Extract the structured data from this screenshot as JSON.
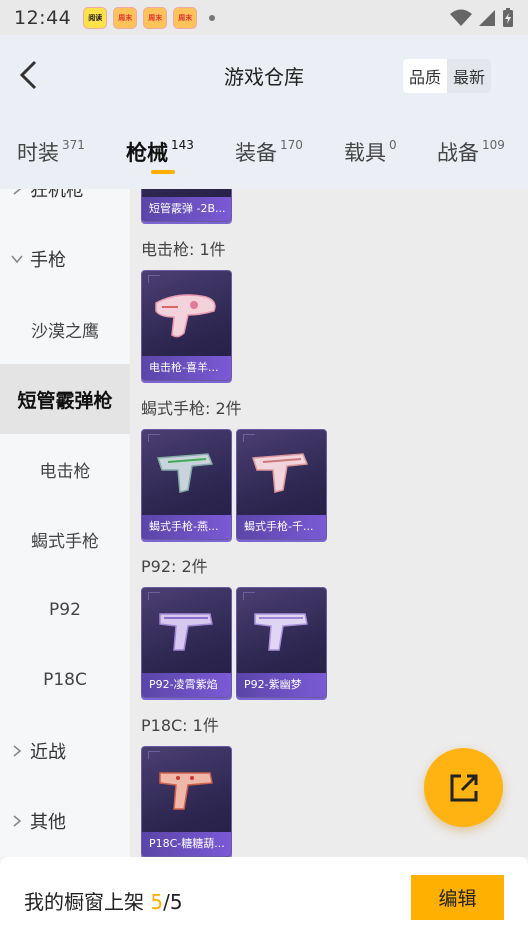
{
  "status_bar": {
    "time": "12:44",
    "apps": [
      "阅读",
      "周末",
      "周末",
      "周末"
    ]
  },
  "header": {
    "title": "游戏仓库",
    "sort_quality": "品质",
    "sort_newest": "最新",
    "back_icon": "chevron-left-icon"
  },
  "tabs": [
    {
      "label": "时装",
      "count": "371"
    },
    {
      "label": "枪械",
      "count": "143"
    },
    {
      "label": "装备",
      "count": "170"
    },
    {
      "label": "载具",
      "count": "0"
    },
    {
      "label": "战备",
      "count": "109"
    }
  ],
  "active_tab_index": 1,
  "accent_color": "#ffb000",
  "sidebar": {
    "items": [
      {
        "label": "狂机枪",
        "type": "group"
      },
      {
        "label": "手枪",
        "type": "group"
      },
      {
        "label": "沙漠之鹰",
        "type": "sub"
      },
      {
        "label": "短管霰弹枪",
        "type": "sub",
        "active": true
      },
      {
        "label": "电击枪",
        "type": "sub"
      },
      {
        "label": "蝎式手枪",
        "type": "sub"
      },
      {
        "label": "P92",
        "type": "sub"
      },
      {
        "label": "P18C",
        "type": "sub"
      },
      {
        "label": "近战",
        "type": "group"
      },
      {
        "label": "其他",
        "type": "group"
      }
    ]
  },
  "content": {
    "partial_card_label": "短管霰弹 -2B...",
    "sections": [
      {
        "title": "电击枪: 1件",
        "items": [
          {
            "label": "电击枪-喜羊..."
          }
        ]
      },
      {
        "title": "蝎式手枪: 2件",
        "items": [
          {
            "label": "蝎式手枪-燕..."
          },
          {
            "label": "蝎式手枪-千..."
          }
        ]
      },
      {
        "title": "P92: 2件",
        "items": [
          {
            "label": "P92-凌霄紫焰"
          },
          {
            "label": "P92-紫幽梦"
          }
        ]
      },
      {
        "title": "P18C: 1件",
        "items": [
          {
            "label": "P18C-糖糖葫..."
          }
        ]
      }
    ]
  },
  "share_icon": "share-external-icon",
  "bottom_bar": {
    "label": "我的橱窗上架",
    "current": "5",
    "separator": "/",
    "total": "5",
    "edit_label": "编辑"
  }
}
